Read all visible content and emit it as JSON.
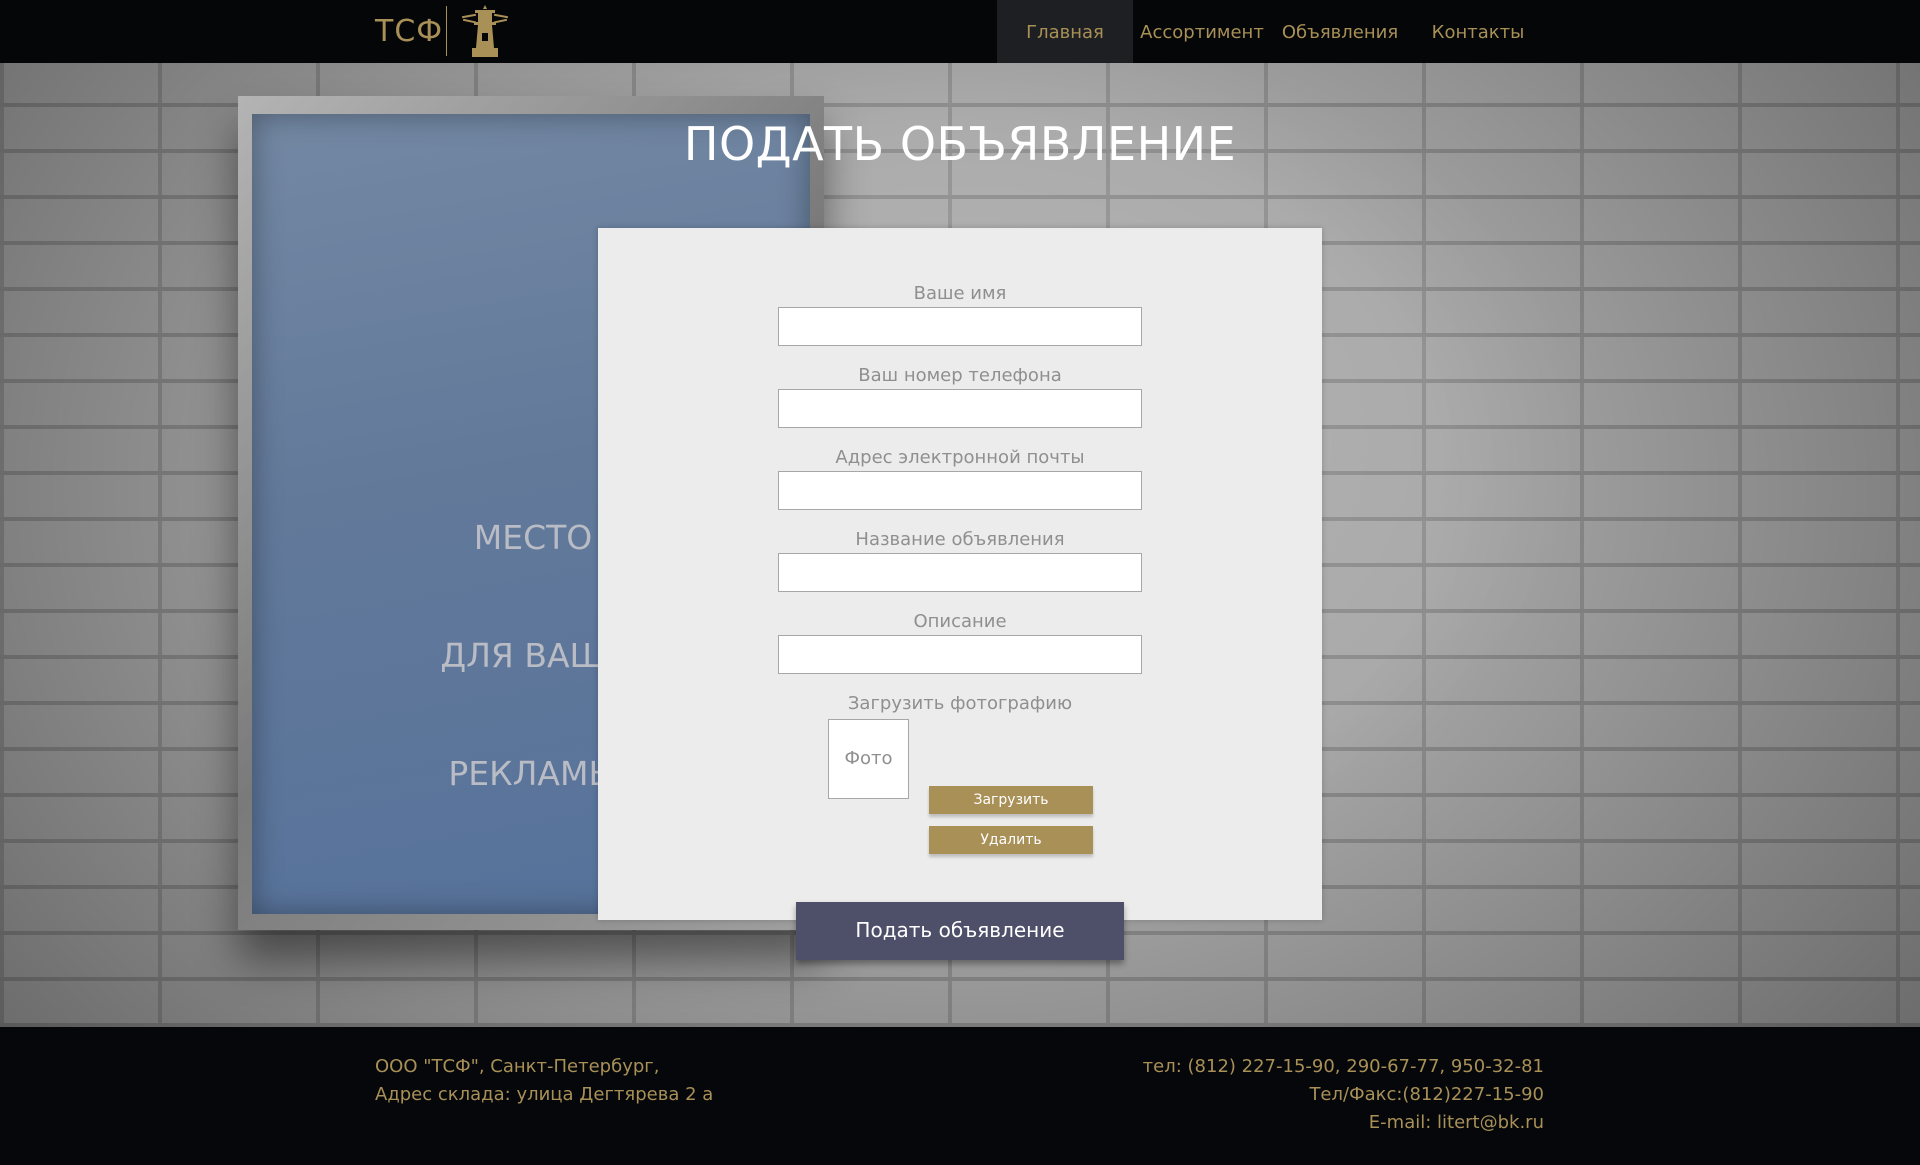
{
  "header": {
    "logo_text": "ТСФ",
    "nav": [
      {
        "label": "Главная",
        "active": true
      },
      {
        "label": "Ассортимент",
        "active": false
      },
      {
        "label": "Объявления",
        "active": false
      },
      {
        "label": "Контакты",
        "active": false
      }
    ]
  },
  "hero": {
    "title": "ПОДАТЬ ОБЪЯВЛЕНИЕ",
    "ad_lines": [
      "МЕСТО",
      "ДЛЯ ВАШЕ",
      "РЕКЛАМЫ"
    ]
  },
  "form": {
    "name_label": "Ваше имя",
    "name_value": "",
    "phone_label": "Ваш номер телефона",
    "phone_value": "",
    "email_label": "Адрес электронной почты",
    "email_value": "",
    "title_label": "Название объявления",
    "title_value": "",
    "description_label": "Описание",
    "description_value": "",
    "photo_label": "Загрузить фотографию",
    "photo_placeholder": "Фото",
    "upload_button": "Загрузить",
    "delete_button": "Удалить",
    "submit_button": "Подать объявление"
  },
  "footer": {
    "company_line": "ООО \"ТСФ\", Санкт-Петербург,",
    "address_line": "Адрес склада: улица Дегтярева 2 а",
    "phone_line": "тел: (812) 227-15-90, 290-67-77, 950-32-81",
    "fax_line": "Тел/Факс:(812)227-15-90",
    "email_line": "E-mail: litert@bk.ru"
  },
  "colors": {
    "accent_gold": "#a89057",
    "submit_button": "#4e4f69",
    "header_bg": "#050608",
    "card_bg": "#ececec"
  },
  "icons": {
    "logo": "lighthouse-icon"
  }
}
